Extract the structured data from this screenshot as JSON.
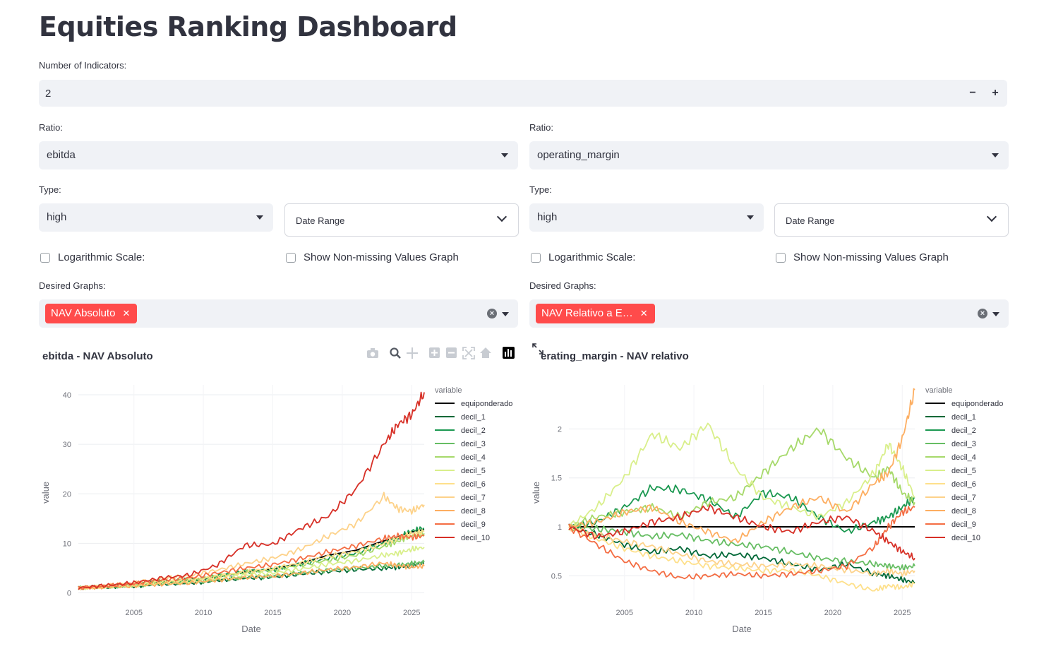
{
  "page_title": "Equities Ranking Dashboard",
  "num_indicators": {
    "label": "Number of Indicators:",
    "value": "2",
    "minus": "−",
    "plus": "+"
  },
  "panels": [
    {
      "ratio_label": "Ratio:",
      "ratio_value": "ebitda",
      "type_label": "Type:",
      "type_value": "high",
      "date_range": "Date Range",
      "log_label": "Logarithmic Scale:",
      "nonmissing_label": "Show Non-missing Values Graph",
      "graphs_label": "Desired Graphs:",
      "graph_tag": "NAV Absoluto",
      "chart_title": "ebitda - NAV Absoluto"
    },
    {
      "ratio_label": "Ratio:",
      "ratio_value": "operating_margin",
      "type_label": "Type:",
      "type_value": "high",
      "date_range": "Date Range",
      "log_label": "Logarithmic Scale:",
      "nonmissing_label": "Show Non-missing Values Graph",
      "graphs_label": "Desired Graphs:",
      "graph_tag": "NAV Relativo a E…",
      "chart_title": "erating_margin - NAV relativo"
    }
  ],
  "icons": {
    "camera": "camera-icon",
    "zoom": "zoom-icon",
    "pan": "pan-icon",
    "zoom_in": "zoom-in-icon",
    "zoom_out": "zoom-out-icon",
    "autoscale": "autoscale-icon",
    "home": "home-icon",
    "plotly": "plotly-logo-icon",
    "fullscreen": "fullscreen-icon"
  },
  "colors": {
    "accent": "#ff4b4b",
    "equiponderado": "#000000",
    "decil_1": "#006837",
    "decil_2": "#1a9850",
    "decil_3": "#66bd63",
    "decil_4": "#a6d96a",
    "decil_5": "#d9ef8b",
    "decil_6": "#fee08b",
    "decil_7": "#fdd28a",
    "decil_8": "#fdae61",
    "decil_9": "#f46d43",
    "decil_10": "#d73027"
  },
  "chart_data": [
    {
      "type": "line",
      "title": "ebitda - NAV Absoluto",
      "xlabel": "Date",
      "ylabel": "value",
      "legend_title": "variable",
      "legend_position": "right",
      "grid": true,
      "xlim": [
        2001,
        2025.9
      ],
      "ylim": [
        -1.5,
        42
      ],
      "x_ticks": [
        "2005",
        "2010",
        "2015",
        "2020",
        "2025"
      ],
      "y_ticks": [
        "0",
        "10",
        "20",
        "30",
        "40"
      ],
      "x": [
        2001,
        2003,
        2005,
        2007,
        2009,
        2011,
        2013,
        2015,
        2017,
        2019,
        2021,
        2023,
        2024,
        2025,
        2025.9
      ],
      "series": [
        {
          "name": "equiponderado",
          "values": [
            1,
            1.3,
            1.6,
            2.2,
            2.5,
            3.2,
            4.2,
            4.8,
            6.0,
            7.6,
            8.6,
            10.5,
            11.3,
            12.3,
            12.8
          ]
        },
        {
          "name": "decil_1",
          "values": [
            1,
            1.2,
            1.4,
            1.8,
            2.0,
            2.5,
            3.0,
            3.2,
            3.8,
            4.3,
            4.7,
            5.0,
            5.2,
            5.5,
            6.0
          ]
        },
        {
          "name": "decil_2",
          "values": [
            1,
            1.3,
            1.7,
            2.3,
            2.6,
            3.4,
            4.3,
            4.7,
            5.8,
            7.0,
            8.0,
            10.0,
            11.0,
            12.5,
            13.0
          ]
        },
        {
          "name": "decil_3",
          "values": [
            1,
            1.2,
            1.5,
            1.9,
            2.1,
            2.6,
            3.1,
            3.4,
            4.0,
            4.6,
            5.0,
            5.4,
            5.6,
            5.9,
            6.2
          ]
        },
        {
          "name": "decil_4",
          "values": [
            1,
            1.3,
            1.6,
            2.2,
            2.5,
            3.3,
            4.1,
            4.6,
            5.6,
            6.6,
            7.6,
            9.4,
            10.4,
            11.6,
            12.0
          ]
        },
        {
          "name": "decil_5",
          "values": [
            1,
            1.2,
            1.5,
            2.0,
            2.2,
            2.9,
            3.6,
            4.0,
            4.8,
            5.8,
            6.5,
            7.6,
            8.0,
            8.8,
            9.2
          ]
        },
        {
          "name": "decil_6",
          "values": [
            1,
            1.3,
            1.7,
            2.2,
            2.6,
            3.3,
            4.2,
            4.9,
            6.0,
            7.4,
            8.3,
            10.0,
            11.0,
            12.0,
            12.3
          ]
        },
        {
          "name": "decil_7",
          "values": [
            1,
            1.4,
            2.0,
            2.9,
            3.4,
            4.6,
            5.9,
            7.0,
            8.8,
            11.5,
            14.0,
            19.5,
            17.0,
            16.5,
            17.8
          ]
        },
        {
          "name": "decil_8",
          "values": [
            1,
            1.2,
            1.4,
            1.8,
            2.0,
            2.6,
            3.1,
            3.4,
            4.0,
            4.7,
            5.2,
            6.0,
            5.5,
            5.2,
            5.4
          ]
        },
        {
          "name": "decil_9",
          "values": [
            1,
            1.4,
            1.9,
            2.6,
            3.0,
            4.0,
            5.0,
            5.7,
            6.9,
            8.3,
            9.5,
            11.0,
            11.5,
            11.2,
            11.5
          ]
        },
        {
          "name": "decil_10",
          "values": [
            1,
            1.5,
            2.0,
            3.0,
            3.6,
            5.6,
            9.6,
            9.8,
            13.0,
            15.5,
            21.0,
            30.0,
            34.0,
            36.0,
            40.5
          ]
        }
      ]
    },
    {
      "type": "line",
      "title": "erating_margin - NAV relativo",
      "xlabel": "Date",
      "ylabel": "value",
      "legend_title": "variable",
      "legend_position": "right",
      "grid": true,
      "xlim": [
        2001,
        2025.9
      ],
      "ylim": [
        0.25,
        2.45
      ],
      "x_ticks": [
        "2005",
        "2010",
        "2015",
        "2020",
        "2025"
      ],
      "y_ticks": [
        "0.5",
        "1",
        "1.5",
        "2"
      ],
      "x": [
        2001,
        2003,
        2005,
        2007,
        2009,
        2011,
        2013,
        2015,
        2017,
        2019,
        2021,
        2023,
        2024,
        2025,
        2025.9
      ],
      "series": [
        {
          "name": "equiponderado",
          "values": [
            1,
            1,
            1,
            1,
            1,
            1,
            1,
            1,
            1,
            1,
            1,
            1,
            1,
            1,
            1
          ]
        },
        {
          "name": "decil_1",
          "values": [
            1,
            0.92,
            0.82,
            0.74,
            0.78,
            0.7,
            0.72,
            0.68,
            0.62,
            0.56,
            0.62,
            0.52,
            0.5,
            0.46,
            0.43
          ]
        },
        {
          "name": "decil_2",
          "values": [
            1,
            1.05,
            1.2,
            1.4,
            1.38,
            1.28,
            1.1,
            1.35,
            1.3,
            1.1,
            0.95,
            1.05,
            1.1,
            1.2,
            1.3
          ]
        },
        {
          "name": "decil_3",
          "values": [
            1,
            0.98,
            0.95,
            0.9,
            0.92,
            0.86,
            0.82,
            0.8,
            0.74,
            0.68,
            0.65,
            0.62,
            0.6,
            0.58,
            0.6
          ]
        },
        {
          "name": "decil_4",
          "values": [
            1,
            1.1,
            1.15,
            1.2,
            1.1,
            1.25,
            1.3,
            1.55,
            1.8,
            2.0,
            1.7,
            1.5,
            1.6,
            1.35,
            1.25
          ]
        },
        {
          "name": "decil_5",
          "values": [
            1,
            1.2,
            1.5,
            1.95,
            1.8,
            2.05,
            1.6,
            1.3,
            1.2,
            1.1,
            1.25,
            1.55,
            1.85,
            1.6,
            1.3
          ]
        },
        {
          "name": "decil_6",
          "values": [
            1,
            0.88,
            0.78,
            0.7,
            0.65,
            0.6,
            0.58,
            0.55,
            0.56,
            0.5,
            0.42,
            0.35,
            0.4,
            0.38,
            0.42
          ]
        },
        {
          "name": "decil_7",
          "values": [
            1,
            0.92,
            0.85,
            0.8,
            0.72,
            0.65,
            0.62,
            0.6,
            0.62,
            0.6,
            0.56,
            0.52,
            0.55,
            0.52,
            0.55
          ]
        },
        {
          "name": "decil_8",
          "values": [
            1,
            1.05,
            1.15,
            1.2,
            1.05,
            0.95,
            0.85,
            1.05,
            1.2,
            1.3,
            1.15,
            1.45,
            1.55,
            1.9,
            2.4
          ]
        },
        {
          "name": "decil_9",
          "values": [
            1,
            0.82,
            0.65,
            0.55,
            0.48,
            0.5,
            0.52,
            0.5,
            0.52,
            0.55,
            0.6,
            0.8,
            1.0,
            1.15,
            1.2
          ]
        },
        {
          "name": "decil_10",
          "values": [
            1,
            0.9,
            0.95,
            1.05,
            1.1,
            1.2,
            1.1,
            1.0,
            0.95,
            1.05,
            1.1,
            0.95,
            0.85,
            0.75,
            0.68
          ]
        }
      ]
    }
  ]
}
